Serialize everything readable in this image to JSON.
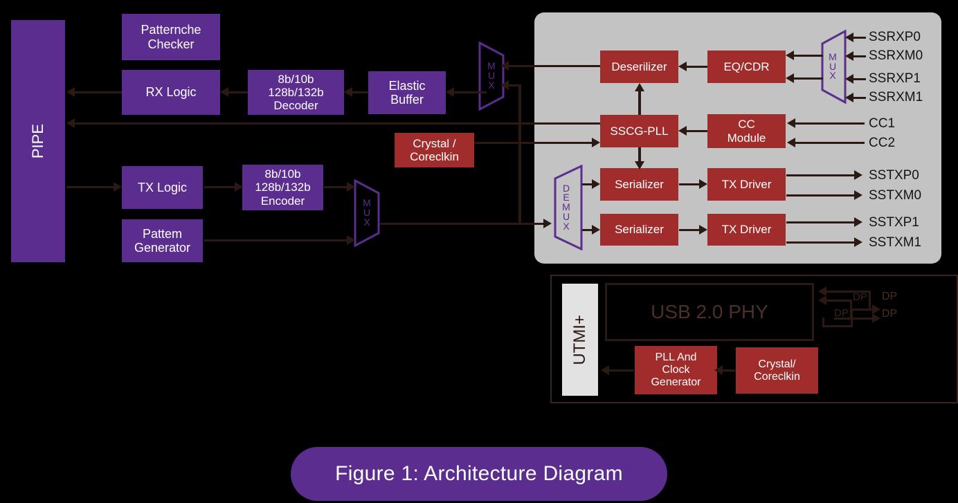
{
  "figure": {
    "caption": "Figure 1:  Architecture Diagram"
  },
  "colors": {
    "purple": "#5b2d8e",
    "red": "#a02c2c",
    "panel_gray": "#c3c3c3",
    "light_gray": "#e2e2e2",
    "line": "#2b1a14",
    "background": "#000000"
  },
  "ss_section": {
    "interface_block": {
      "label": "PIPE"
    },
    "digital_blocks": [
      {
        "id": "pattern-checker",
        "label": "Patternche\nChecker"
      },
      {
        "id": "rx-logic",
        "label": "RX Logic"
      },
      {
        "id": "decoder",
        "label": "8b/10b\n128b/132b\nDecoder"
      },
      {
        "id": "elastic-buffer",
        "label": "Elastic\nBuffer"
      },
      {
        "id": "tx-logic",
        "label": "TX Logic"
      },
      {
        "id": "encoder",
        "label": "8b/10b\n128b/132b\nEncoder"
      },
      {
        "id": "pattern-generator",
        "label": "Pattem\nGenerator"
      }
    ],
    "clock_block": {
      "label": "Crystal /\nCoreclkin"
    },
    "analog_blocks": [
      {
        "id": "deserializer",
        "label": "Deserilizer"
      },
      {
        "id": "eq-cdr",
        "label": "EQ/CDR"
      },
      {
        "id": "sscg-pll",
        "label": "SSCG-PLL"
      },
      {
        "id": "cc-module",
        "label": "CC\nModule"
      },
      {
        "id": "serializer-0",
        "label": "Serializer"
      },
      {
        "id": "tx-driver-0",
        "label": "TX Driver"
      },
      {
        "id": "serializer-1",
        "label": "Serializer"
      },
      {
        "id": "tx-driver-1",
        "label": "TX Driver"
      }
    ],
    "muxes": [
      {
        "id": "rx-mux",
        "label": "MUX"
      },
      {
        "id": "tx-mux",
        "label": "MUX"
      },
      {
        "id": "demux",
        "label": "DEMUX"
      },
      {
        "id": "pad-mux",
        "label": "MUX"
      }
    ],
    "rx_pins": [
      "SSRXP0",
      "SSRXM0",
      "SSRXP1",
      "SSRXM1"
    ],
    "cc_pins": [
      "CC1",
      "CC2"
    ],
    "tx_pins": [
      "SSTXP0",
      "SSTXM0",
      "SSTXP1",
      "SSTXM1"
    ]
  },
  "hs_section": {
    "interface_block": {
      "label": "UTMI+"
    },
    "phy_block": {
      "label": "USB 2.0 PHY"
    },
    "blocks": [
      {
        "id": "pll-clock-generator",
        "label": "PLL And\nClock\nGenerator"
      },
      {
        "id": "crystal-coreclkin",
        "label": "Crystal/\nCoreclkin"
      }
    ],
    "inner_pins": [
      "DP",
      "DP"
    ],
    "outer_pins": [
      "DP",
      "DP"
    ]
  }
}
